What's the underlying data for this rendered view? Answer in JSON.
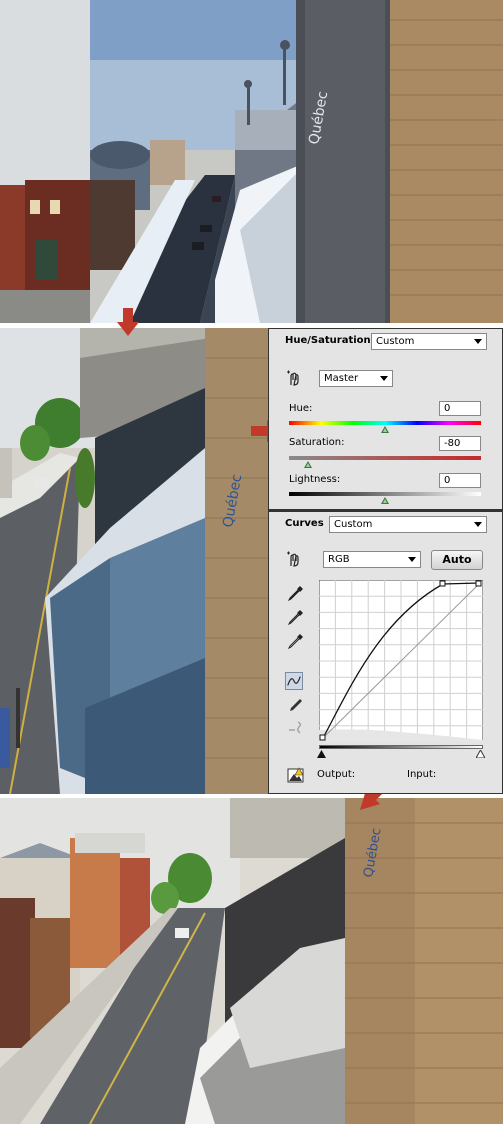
{
  "hue_saturation": {
    "title": "Hue/Saturation",
    "preset": "Custom",
    "channel": "Master",
    "hue_label": "Hue:",
    "hue_value": "0",
    "saturation_label": "Saturation:",
    "saturation_value": "-80",
    "lightness_label": "Lightness:",
    "lightness_value": "0",
    "hue_level": 0.5,
    "saturation_level": 0.1,
    "lightness_level": 0.5
  },
  "curves": {
    "title": "Curves",
    "preset": "Custom",
    "channel": "RGB",
    "auto_label": "Auto",
    "output_label": "Output:",
    "input_label": "Input:"
  },
  "colors": {
    "arrow": "#c0392b",
    "panel_bg": "#e4e4e4",
    "slider_thumb": "#3a7a3a"
  },
  "icons": {
    "targeted_adjust": "hand-target-icon",
    "black_eyedropper": "eyedropper-black-icon",
    "gray_eyedropper": "eyedropper-gray-icon",
    "white_eyedropper": "eyedropper-white-icon",
    "curve_point_tool": "curve-point-icon",
    "pencil_tool": "pencil-icon",
    "smooth_tool": "smooth-curve-icon",
    "clipping": "clipping-warning-icon"
  }
}
